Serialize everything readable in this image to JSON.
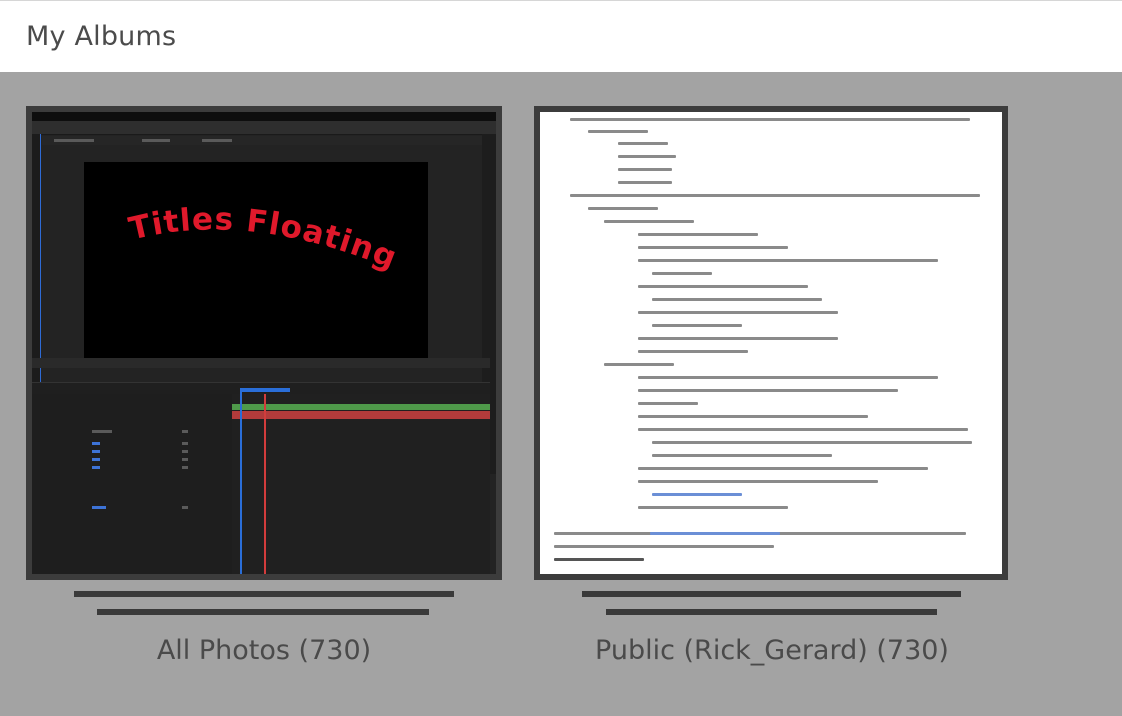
{
  "header": {
    "title": "My Albums"
  },
  "albums": [
    {
      "label": "All Photos (730)",
      "thumbnail": {
        "kind": "after-effects-screenshot",
        "overlay_text": "Titles Floating",
        "overlay_color": "#e0192b"
      }
    },
    {
      "label": "Public (Rick_Gerard) (730)",
      "thumbnail": {
        "kind": "document-screenshot"
      }
    }
  ],
  "colors": {
    "page_bg": "#a3a3a3",
    "header_bg": "#ffffff",
    "frame": "#3c3c3c",
    "label_text": "#4a4a4a"
  }
}
